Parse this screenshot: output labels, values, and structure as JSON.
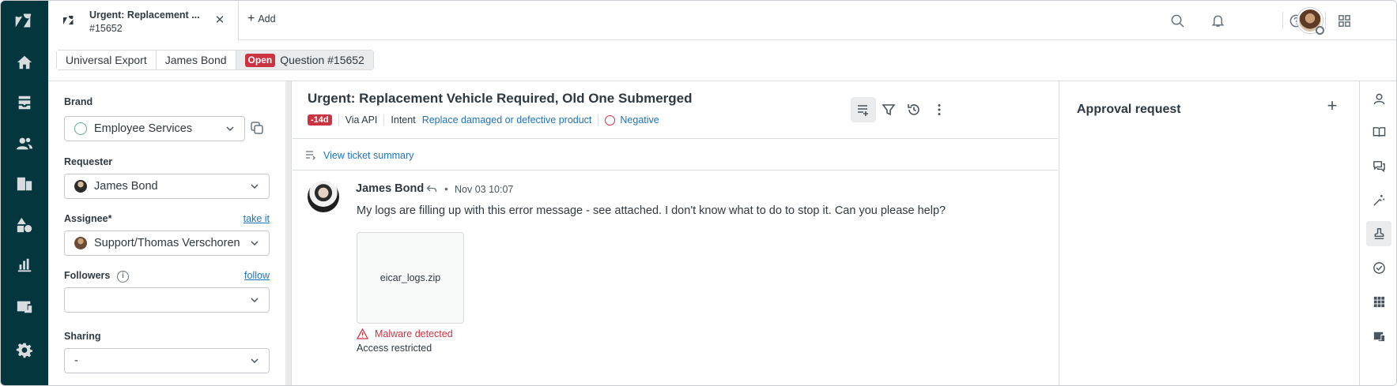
{
  "tab": {
    "title": "Urgent: Replacement ...",
    "subtitle": "#15652",
    "add_label": "Add"
  },
  "breadcrumb": {
    "org": "Universal Export",
    "user": "James Bond",
    "status": "Open",
    "ticket": "Question #15652"
  },
  "properties": {
    "brand": {
      "label": "Brand",
      "value": "Employee Services"
    },
    "requester": {
      "label": "Requester",
      "value": "James Bond"
    },
    "assignee": {
      "label": "Assignee*",
      "link": "take it",
      "value": "Support/Thomas Verschoren"
    },
    "followers": {
      "label": "Followers",
      "link": "follow",
      "value": ""
    },
    "sharing": {
      "label": "Sharing",
      "value": "-"
    }
  },
  "ticket": {
    "title": "Urgent: Replacement Vehicle Required, Old One Submerged",
    "age": "-14d",
    "channel": "Via API",
    "intent_label": "Intent",
    "intent_value": "Replace damaged or defective product",
    "sentiment": "Negative",
    "summary_link": "View ticket summary"
  },
  "message": {
    "author": "James Bond",
    "timestamp": "Nov 03 10:07",
    "body": "My logs are filling up with this error message - see attached. I don't know what to do to stop it. Can you please help?",
    "attachment": "eicar_logs.zip",
    "malware": "Malware detected",
    "restricted": "Access restricted"
  },
  "right_panel": {
    "title": "Approval request"
  },
  "colors": {
    "nav_bg": "#03363d",
    "danger": "#cc3340",
    "link": "#1f73b7"
  }
}
